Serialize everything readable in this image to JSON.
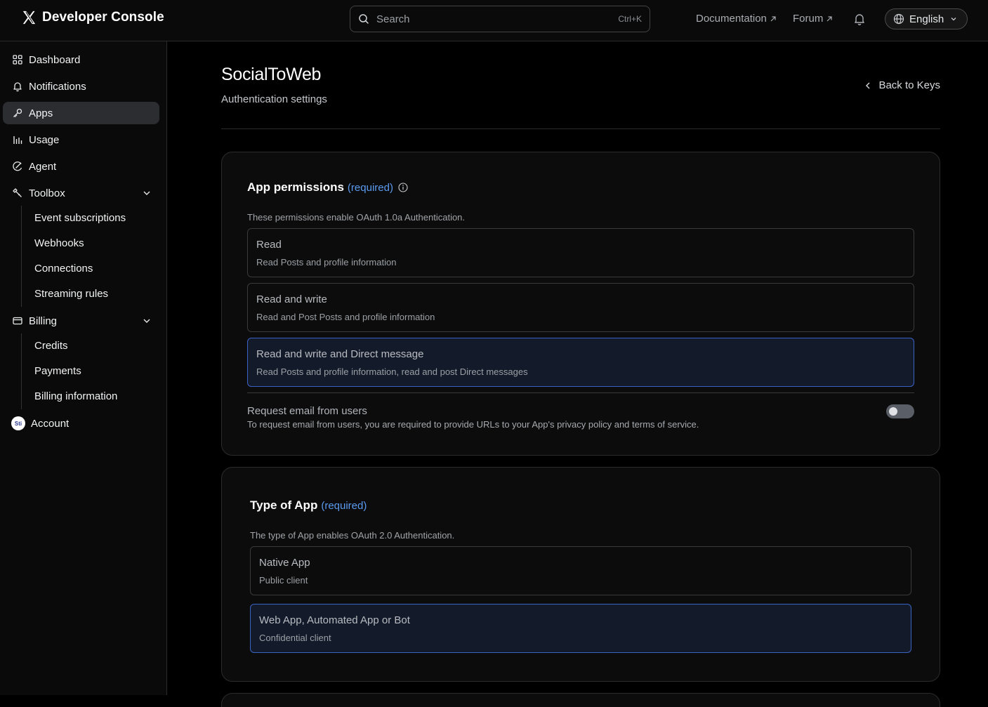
{
  "header": {
    "brand_name": "Developer Console",
    "search_placeholder": "Search",
    "search_shortcut": "Ctrl+K",
    "documentation_label": "Documentation",
    "forum_label": "Forum",
    "language_label": "English"
  },
  "sidebar": {
    "dashboard": "Dashboard",
    "notifications": "Notifications",
    "apps": "Apps",
    "usage": "Usage",
    "agent": "Agent",
    "toolbox": "Toolbox",
    "toolbox_items": [
      "Event subscriptions",
      "Webhooks",
      "Connections",
      "Streaming rules"
    ],
    "billing": "Billing",
    "billing_items": [
      "Credits",
      "Payments",
      "Billing information"
    ],
    "account": "Account",
    "account_avatar_text": "Sti"
  },
  "main": {
    "title": "SocialToWeb",
    "subtitle": "Authentication settings",
    "back_label": "Back to Keys",
    "permissions": {
      "title": "App permissions",
      "required": "(required)",
      "description": "These permissions enable OAuth 1.0a Authentication.",
      "options": [
        {
          "title": "Read",
          "desc": "Read Posts and profile information"
        },
        {
          "title": "Read and write",
          "desc": "Read and Post Posts and profile information"
        },
        {
          "title": "Read and write and Direct message",
          "desc": "Read Posts and profile information, read and post Direct messages"
        }
      ],
      "email_title": "Request email from users",
      "email_desc": "To request email from users, you are required to provide URLs to your App's privacy policy and terms of service."
    },
    "app_type": {
      "title": "Type of App",
      "required": "(required)",
      "description": "The type of App enables OAuth 2.0 Authentication.",
      "options": [
        {
          "title": "Native App",
          "desc": "Public client"
        },
        {
          "title": "Web App, Automated App or Bot",
          "desc": "Confidential client"
        }
      ]
    }
  },
  "colors": {
    "accent": "#5b9bf0",
    "selected_border": "#3b63c4",
    "background": "#000000"
  }
}
